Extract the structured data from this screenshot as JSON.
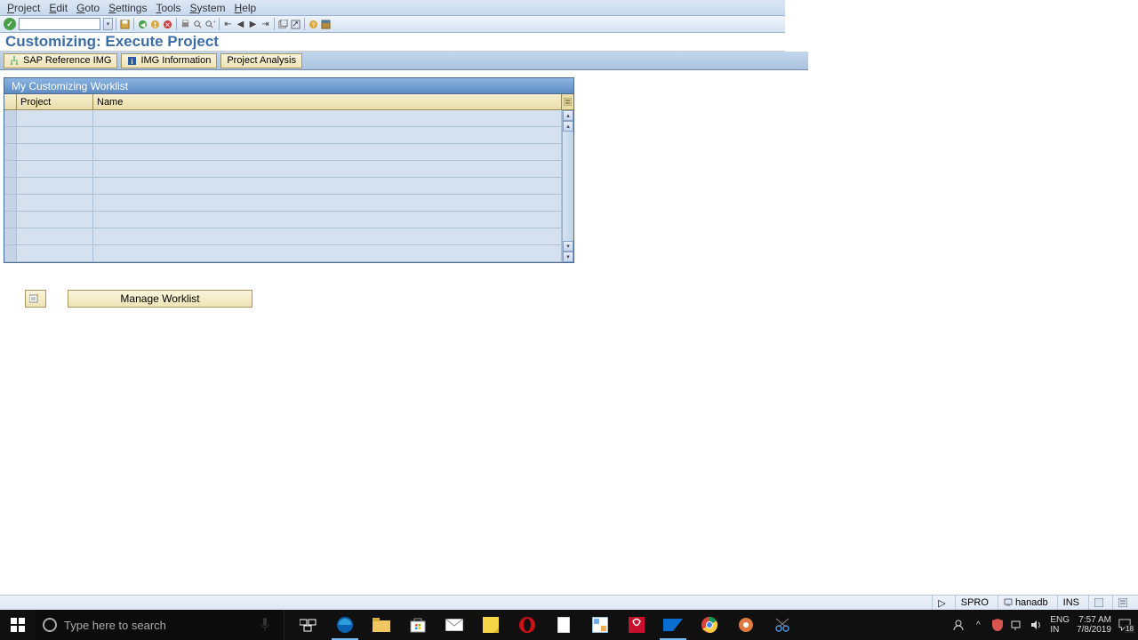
{
  "menu": [
    "Project",
    "Edit",
    "Goto",
    "Settings",
    "Tools",
    "System",
    "Help"
  ],
  "title": "Customizing: Execute Project",
  "app_buttons": {
    "sap_ref": "SAP Reference IMG",
    "img_info": "IMG Information",
    "proj_analysis": "Project Analysis"
  },
  "panel_title": "My Customizing Worklist",
  "columns": {
    "project": "Project",
    "name": "Name"
  },
  "rows_blank_count": 9,
  "manage_worklist": "Manage Worklist",
  "status": {
    "tcode": "SPRO",
    "system": "hanadb",
    "mode": "INS"
  },
  "taskbar": {
    "search_placeholder": "Type here to search",
    "lang": "ENG",
    "lang_sub": "IN",
    "time": "7:57 AM",
    "date": "7/8/2019",
    "notif_count": "18"
  }
}
